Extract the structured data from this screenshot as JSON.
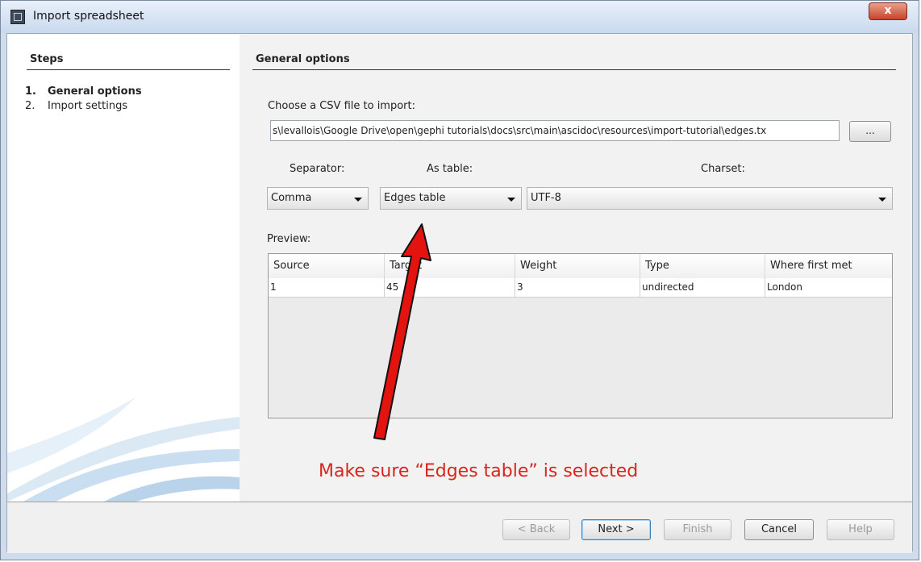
{
  "window": {
    "title": "Import spreadsheet",
    "close_label": "x"
  },
  "steps": {
    "heading": "Steps",
    "items": [
      {
        "num": "1.",
        "label": "General options"
      },
      {
        "num": "2.",
        "label": "Import settings"
      }
    ]
  },
  "general": {
    "heading": "General options",
    "file_label": "Choose a CSV file to import:",
    "file_path": "s\\levallois\\Google Drive\\open\\gephi tutorials\\docs\\src\\main\\ascidoc\\resources\\import-tutorial\\edges.tx",
    "browse_label": "...",
    "separator_label": "Separator:",
    "separator_value": "Comma",
    "as_table_label": "As table:",
    "as_table_value": "Edges table",
    "charset_label": "Charset:",
    "charset_value": "UTF-8",
    "preview_label": "Preview:"
  },
  "preview": {
    "columns": [
      "Source",
      "Target",
      "Weight",
      "Type",
      "Where first met"
    ],
    "rows": [
      [
        "1",
        "45",
        "3",
        "undirected",
        "London"
      ]
    ]
  },
  "annotation": {
    "text": "Make sure “Edges table” is selected",
    "color": "#d9261c"
  },
  "buttons": {
    "back": "< Back",
    "next": "Next >",
    "finish": "Finish",
    "cancel": "Cancel",
    "help": "Help"
  }
}
